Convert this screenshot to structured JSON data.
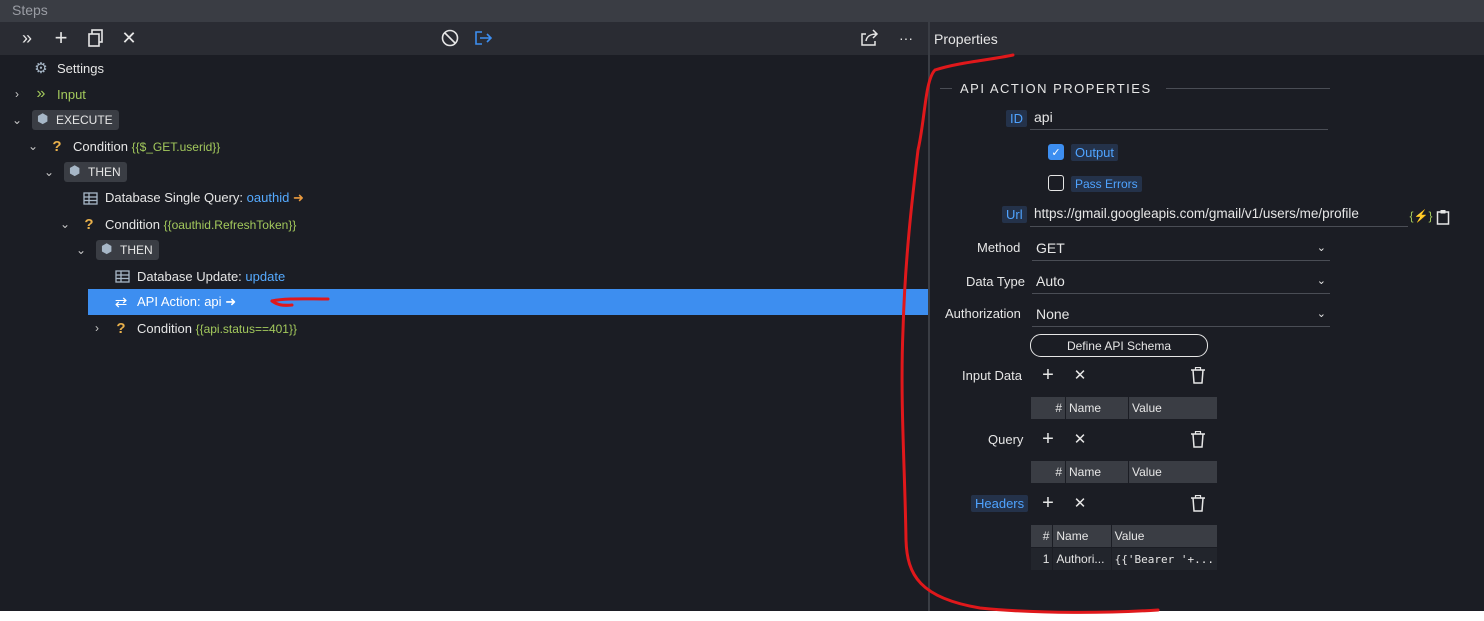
{
  "steps_panel": {
    "title": "Steps"
  },
  "properties_panel": {
    "title": "Properties"
  },
  "tree": {
    "settings": "Settings",
    "input": "Input",
    "execute": "EXECUTE",
    "condition1": {
      "label": "Condition",
      "expr": "{{$_GET.userid}}"
    },
    "then1": "THEN",
    "db_single": {
      "label": "Database Single Query:",
      "name": "oauthid"
    },
    "condition2": {
      "label": "Condition",
      "expr": "{{oauthid.RefreshToken}}"
    },
    "then2": "THEN",
    "db_update": {
      "label": "Database Update:",
      "name": "update"
    },
    "api_action": {
      "label": "API Action: api"
    },
    "condition3": {
      "label": "Condition",
      "expr": "{{api.status==401}}"
    }
  },
  "props": {
    "section_title": "API ACTION PROPERTIES",
    "id_label": "ID",
    "id_value": "api",
    "output_label": "Output",
    "output_checked": true,
    "pass_errors_label": "Pass Errors",
    "pass_errors_checked": false,
    "url_label": "Url",
    "url_value": "https://gmail.googleapis.com/gmail/v1/users/me/profile",
    "method_label": "Method",
    "method_value": "GET",
    "data_type_label": "Data Type",
    "data_type_value": "Auto",
    "auth_label": "Authorization",
    "auth_value": "None",
    "define_schema": "Define API Schema",
    "input_data_label": "Input Data",
    "query_label": "Query",
    "headers_label": "Headers",
    "table_headers": [
      "#",
      "Name",
      "Value"
    ],
    "headers_rows": [
      {
        "num": "1",
        "name": "Authori...",
        "value": "{{'Bearer '+..."
      }
    ]
  },
  "colors": {
    "accent": "#3d8ef0",
    "annotation": "#e0181b",
    "background": "#1b1d24"
  }
}
